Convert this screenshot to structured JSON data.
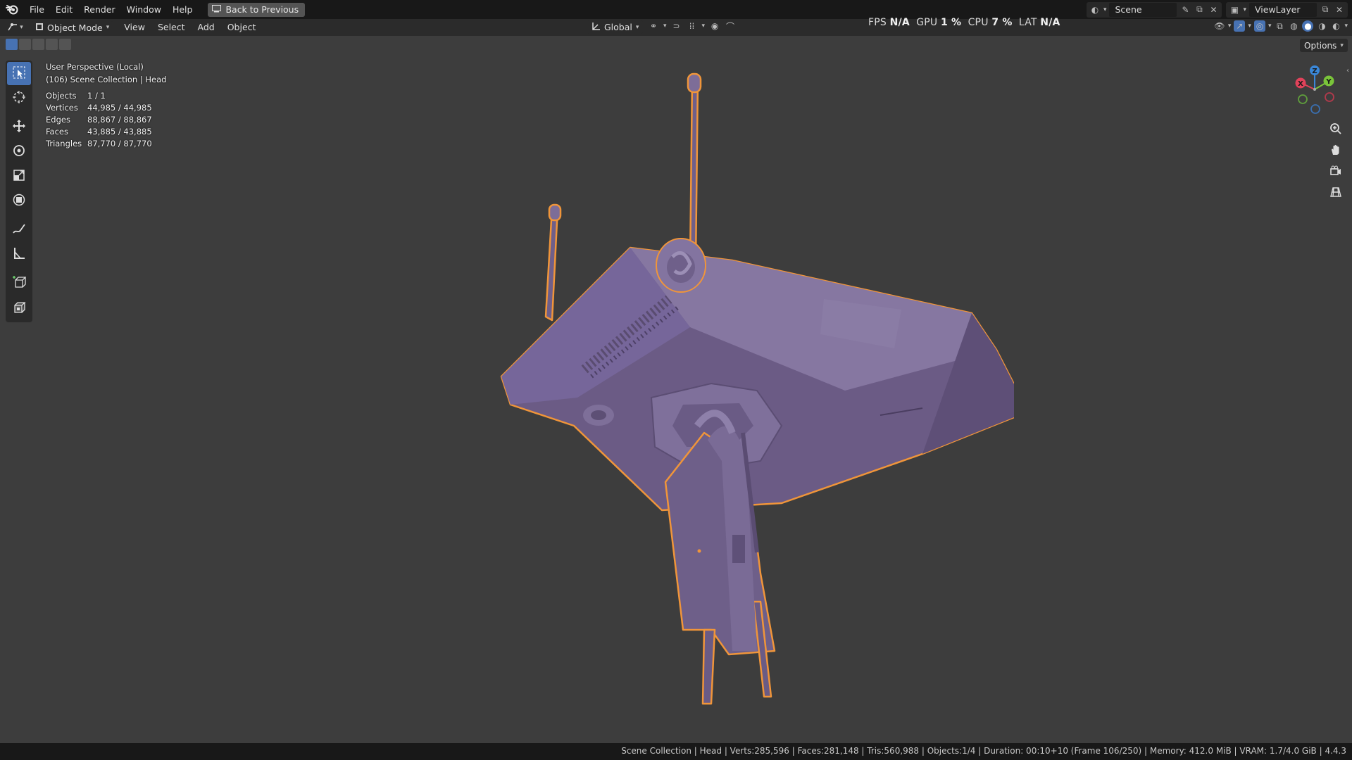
{
  "menubar": {
    "items": [
      "File",
      "Edit",
      "Render",
      "Window",
      "Help"
    ],
    "back_button": "Back to Previous",
    "scene_name": "Scene",
    "view_layer": "ViewLayer"
  },
  "header": {
    "mode": "Object Mode",
    "menus": [
      "View",
      "Select",
      "Add",
      "Object"
    ],
    "orientation": "Global",
    "options_label": "Options"
  },
  "perf": {
    "fps_label": "FPS",
    "fps_value": "N/A",
    "gpu_label": "GPU",
    "gpu_value": "1 %",
    "cpu_label": "CPU",
    "cpu_value": "7 %",
    "lat_label": "LAT",
    "lat_value": "N/A"
  },
  "overlay": {
    "view_name": "User Perspective (Local)",
    "collection": "(106) Scene Collection | Head",
    "stats": [
      {
        "label": "Objects",
        "value": "1 / 1"
      },
      {
        "label": "Vertices",
        "value": "44,985 / 44,985"
      },
      {
        "label": "Edges",
        "value": "88,867 / 88,867"
      },
      {
        "label": "Faces",
        "value": "43,885 / 43,885"
      },
      {
        "label": "Triangles",
        "value": "87,770 / 87,770"
      }
    ]
  },
  "gizmo": {
    "x": "X",
    "y": "Y",
    "z": "Z"
  },
  "statusbar": {
    "text": "Scene Collection | Head | Verts:285,596 | Faces:281,148 | Tris:560,988 | Objects:1/4 | Duration: 00:10+10 (Frame 106/250) | Memory: 412.0 MiB | VRAM: 1.7/4.0 GiB | 4.4.3"
  },
  "colors": {
    "model_fill": "#7a6a94",
    "selection_outline": "#f0953a",
    "active_blue": "#4772b3"
  }
}
